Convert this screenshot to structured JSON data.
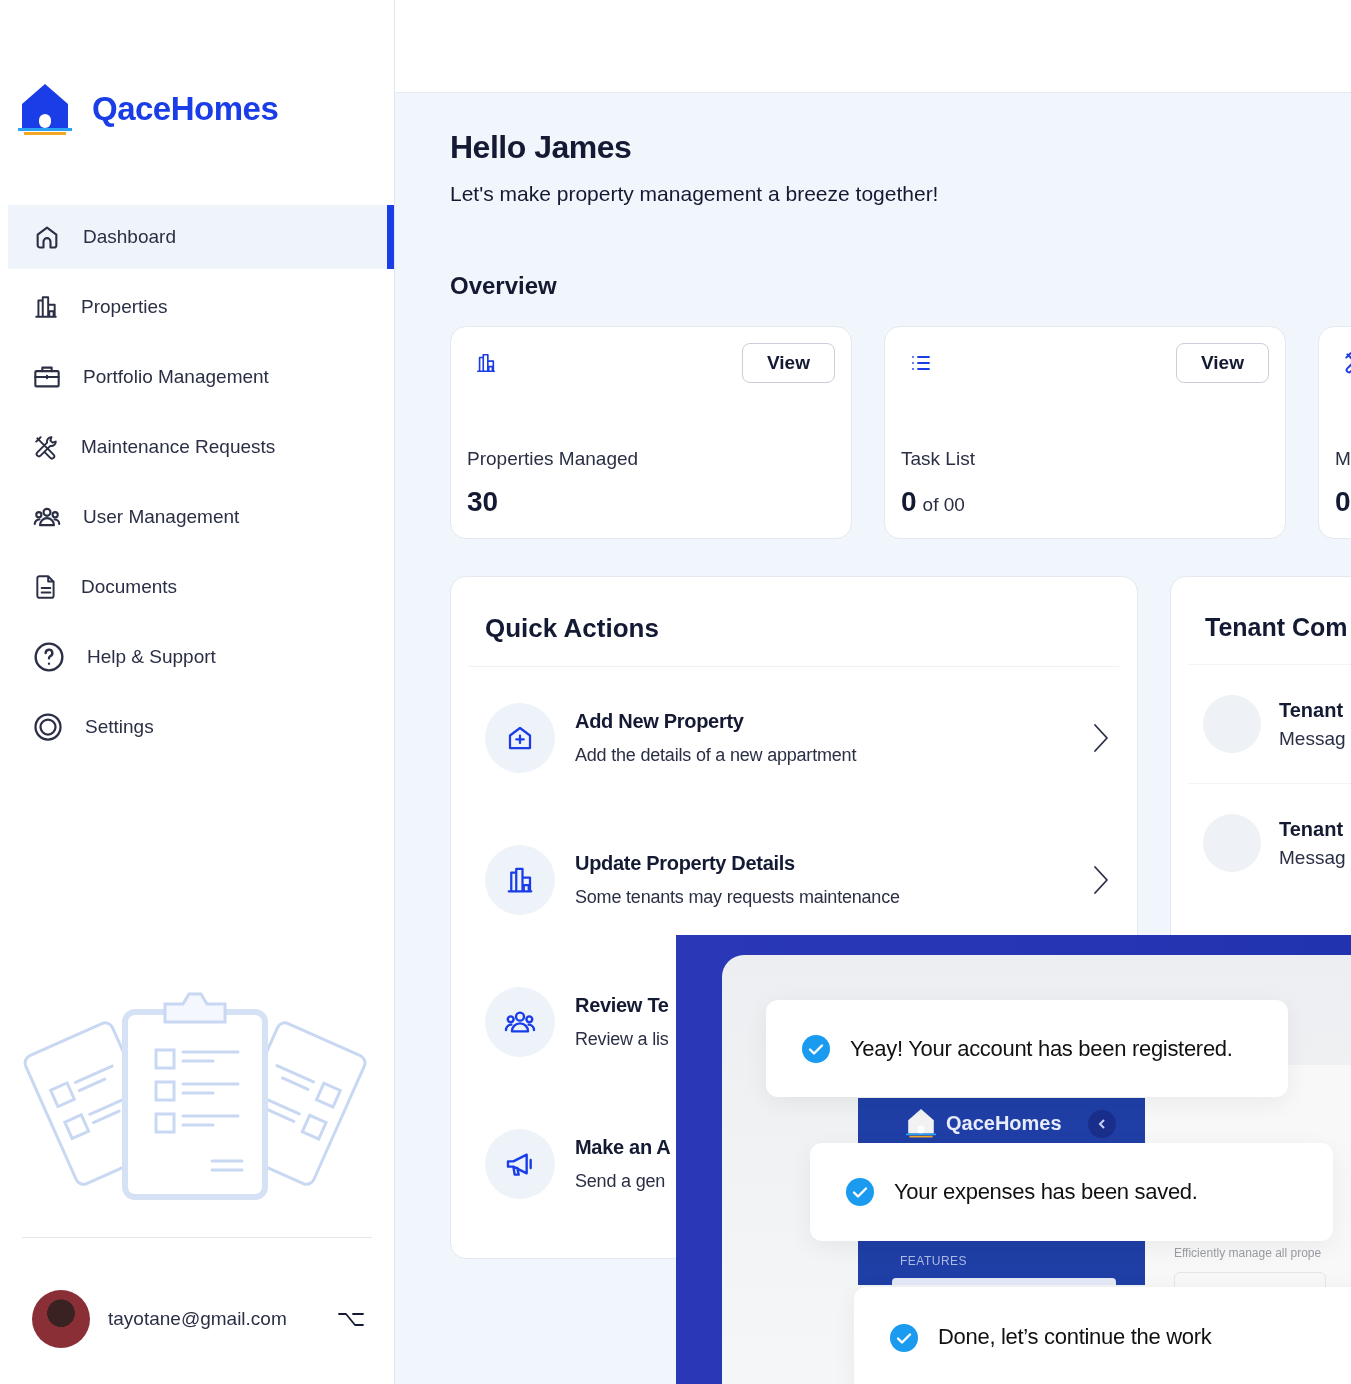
{
  "sidebar": {
    "brand": "QaceHomes",
    "nav": [
      {
        "label": "Dashboard",
        "selected": true
      },
      {
        "label": "Properties",
        "selected": false
      },
      {
        "label": "Portfolio Management",
        "selected": false
      },
      {
        "label": "Maintenance Requests",
        "selected": false
      },
      {
        "label": "User Management",
        "selected": false
      },
      {
        "label": "Documents",
        "selected": false
      },
      {
        "label": "Help & Support",
        "selected": false
      },
      {
        "label": "Settings",
        "selected": false
      }
    ],
    "user": {
      "email": "tayotane@gmail.com"
    }
  },
  "header": {
    "title": "Hello James",
    "subtitle": "Let's make property management a breeze together!"
  },
  "overview": {
    "title": "Overview",
    "cards": [
      {
        "label": "Properties Managed",
        "value": "30",
        "button": "View"
      },
      {
        "label": "Task List",
        "value": "0",
        "suffix": "of 00",
        "button": "View"
      },
      {
        "label": "M",
        "value": "0"
      }
    ]
  },
  "quick_actions": {
    "title": "Quick Actions",
    "items": [
      {
        "title": "Add New Property",
        "description": "Add the details of a new appartment"
      },
      {
        "title": "Update Property Details",
        "description": "Some tenants may requests maintenance"
      },
      {
        "title": "Review Te",
        "description": "Review a lis"
      },
      {
        "title": "Make an A",
        "description": "Send a gen"
      }
    ]
  },
  "tenant_communication": {
    "title": "Tenant Com",
    "messages": [
      {
        "name": "Tenant",
        "preview": "Messag"
      },
      {
        "name": "Tenant",
        "preview": "Messag"
      }
    ]
  },
  "promo_overlay": {
    "toasts": [
      "Yeay! Your account has been registered.",
      "Your expenses has been saved.",
      "Done, let’s continue the work"
    ],
    "app_preview": {
      "brand": "QaceHomes",
      "section": "FEATURES",
      "caption": "Efficiently manage all prope"
    }
  }
}
